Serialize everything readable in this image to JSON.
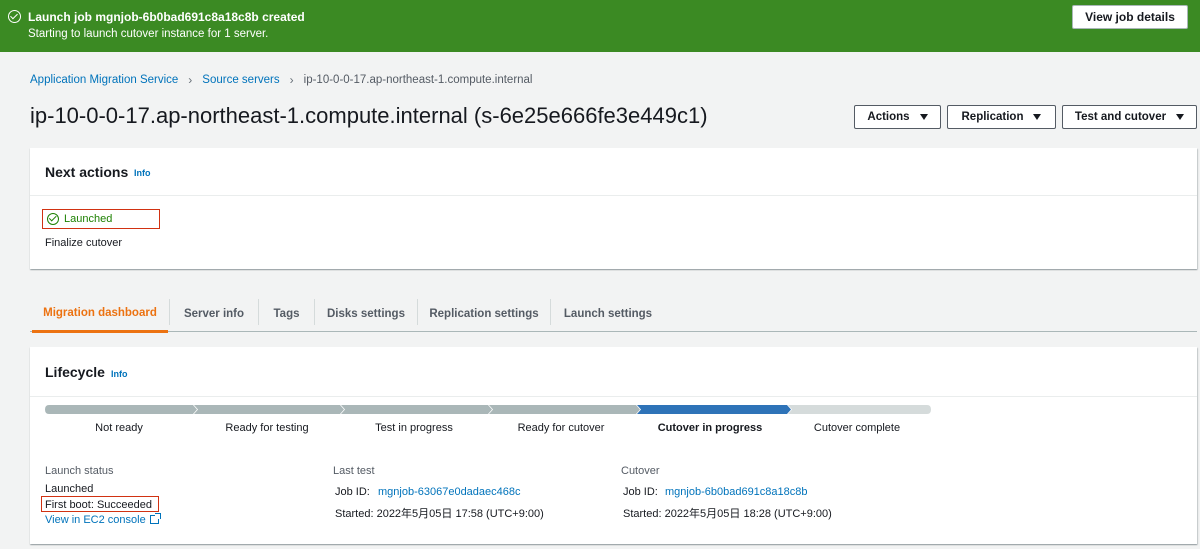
{
  "flash": {
    "title": "Launch job mgnjob-6b0bad691c8a18c8b created",
    "subtitle": "Starting to launch cutover instance for 1 server.",
    "button": "View job details",
    "color": "#3b8a23"
  },
  "breadcrumb": {
    "items": [
      "Application Migration Service",
      "Source servers"
    ],
    "current": "ip-10-0-0-17.ap-northeast-1.compute.internal"
  },
  "page": {
    "title": "ip-10-0-0-17.ap-northeast-1.compute.internal (s-6e25e666fe3e449c1)"
  },
  "header_buttons": {
    "actions": "Actions",
    "replication": "Replication",
    "test_cutover": "Test and cutover"
  },
  "next_actions": {
    "title": "Next actions",
    "info": "Info",
    "status": "Launched",
    "finalize": "Finalize cutover"
  },
  "tabs": [
    "Migration dashboard",
    "Server info",
    "Tags",
    "Disks settings",
    "Replication settings",
    "Launch settings"
  ],
  "lifecycle": {
    "title": "Lifecycle",
    "info": "Info",
    "stages": [
      "Not ready",
      "Ready for testing",
      "Test in progress",
      "Ready for cutover",
      "Cutover in progress",
      "Cutover complete"
    ],
    "active_index": 4,
    "launch_status": {
      "label": "Launch status",
      "value": "Launched",
      "first_boot": "First boot: Succeeded",
      "ec2_link": "View in EC2 console"
    },
    "last_test": {
      "label": "Last test",
      "job_id_label": "Job ID:",
      "job_id": "mgnjob-63067e0dadaec468c",
      "started": "Started: 2022年5月05日 17:58 (UTC+9:00)"
    },
    "cutover": {
      "label": "Cutover",
      "job_id_label": "Job ID:",
      "job_id": "mgnjob-6b0bad691c8a18c8b",
      "started": "Started: 2022年5月05日 18:28 (UTC+9:00)"
    }
  },
  "colors": {
    "link": "#0073bb",
    "tab_active": "#ec7211",
    "stage_done": "#aab7b8",
    "stage_active": "#2e73b8",
    "stage_todo": "#d5dbdb",
    "highlight": "#d13212"
  }
}
